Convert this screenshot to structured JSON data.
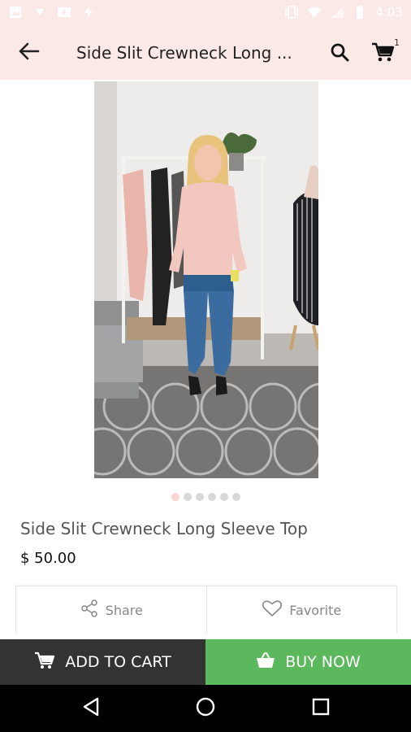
{
  "status_bar": {
    "time": "4:03"
  },
  "app_bar": {
    "title": "Side Slit Crewneck Long ...",
    "cart_count": "1"
  },
  "product": {
    "name": "Side Slit Crewneck Long Sleeve Top",
    "price": "$ 50.00",
    "image_count": 6,
    "active_image": 1
  },
  "actions": {
    "share_label": "Share",
    "favorite_label": "Favorite"
  },
  "bottom_bar": {
    "add_to_cart_label": "ADD TO CART",
    "buy_now_label": "BUY NOW"
  },
  "colors": {
    "app_bar_bg": "#fbe9e7",
    "add_to_cart_bg": "#333333",
    "buy_now_bg": "#5cb85c",
    "active_dot": "#f7d6d0"
  }
}
